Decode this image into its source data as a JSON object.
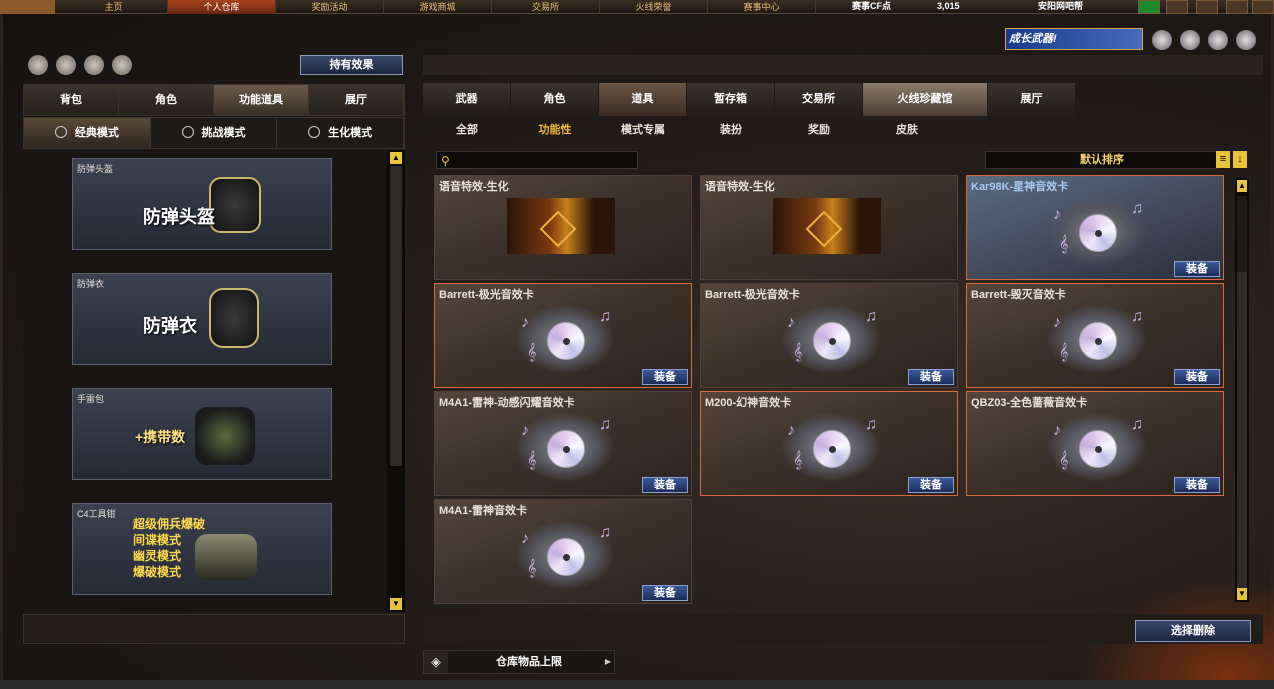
{
  "top_nav": {
    "items": [
      "主页",
      "个人仓库",
      "奖励活动",
      "游戏商城",
      "交易所",
      "火线荣誉",
      "赛事中心"
    ],
    "stat_label": "赛事CF点",
    "points": "3,015",
    "user": "安阳网吧帮"
  },
  "banner": {
    "text": "成长武器!"
  },
  "left": {
    "effect_button": "持有效果",
    "tabs": [
      "背包",
      "角色",
      "功能道具",
      "展厅"
    ],
    "active_tab": "功能道具",
    "modes": [
      "经典模式",
      "挑战模式",
      "生化模式"
    ],
    "active_mode": "经典模式",
    "items": [
      {
        "tag": "防弹头盔",
        "label": "防弹头盔"
      },
      {
        "tag": "防弹衣",
        "label": "防弹衣"
      },
      {
        "tag": "手雷包",
        "label": "+携带数"
      },
      {
        "tag": "C4工具钳",
        "label": "超级佣兵爆破\n间谍模式\n幽灵模式\n爆破模式"
      }
    ]
  },
  "right": {
    "tabs": [
      "武器",
      "角色",
      "道具",
      "暂存箱",
      "交易所",
      "火线珍藏馆",
      "展厅"
    ],
    "active_tab": "道具",
    "subtabs": [
      "全部",
      "功能性",
      "模式专属",
      "装扮",
      "奖励",
      "皮肤"
    ],
    "active_subtab": "功能性",
    "search": {
      "placeholder": ""
    },
    "sort_label": "默认排序",
    "equip_label": "装备",
    "cards": [
      {
        "name": "语音特效-生化",
        "kind": "voice"
      },
      {
        "name": "语音特效-生化",
        "kind": "voice"
      },
      {
        "name": "Kar98K-星神音效卡",
        "kind": "cd",
        "style": "blue",
        "equip": true
      },
      {
        "name": "Barrett-极光音效卡",
        "kind": "cd",
        "style": "sel",
        "equip": true
      },
      {
        "name": "Barrett-极光音效卡",
        "kind": "cd",
        "style": "plain",
        "equip": true
      },
      {
        "name": "Barrett-毁灭音效卡",
        "kind": "cd",
        "style": "sel",
        "equip": true
      },
      {
        "name": "M4A1-雷神-动感闪耀音效卡",
        "kind": "cd",
        "style": "plain",
        "equip": true
      },
      {
        "name": "M200-幻神音效卡",
        "kind": "cd",
        "style": "sel",
        "equip": true
      },
      {
        "name": "QBZ03-全色蔷薇音效卡",
        "kind": "cd",
        "style": "sel",
        "equip": true
      },
      {
        "name": "M4A1-雷神音效卡",
        "kind": "cd",
        "style": "plain",
        "equip": true
      }
    ],
    "clear_button": "选择删除",
    "storage_label": "仓库物品上限"
  }
}
